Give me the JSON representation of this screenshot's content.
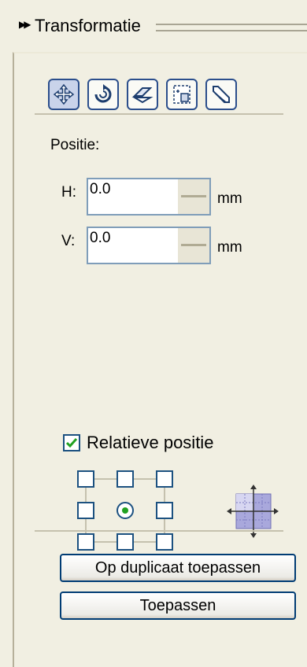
{
  "title": "Transformatie",
  "toolbar": {
    "buttons": [
      {
        "name": "position-icon",
        "active": true
      },
      {
        "name": "rotate-icon",
        "active": false
      },
      {
        "name": "mirror-icon",
        "active": false
      },
      {
        "name": "size-icon",
        "active": false
      },
      {
        "name": "skew-icon",
        "active": false
      }
    ]
  },
  "position": {
    "heading": "Positie:",
    "h_label": "H:",
    "h_value": "0.0",
    "h_unit": "mm",
    "v_label": "V:",
    "v_value": "0.0",
    "v_unit": "mm"
  },
  "relative": {
    "label": "Relatieve positie",
    "checked": true,
    "selected_anchor": "center"
  },
  "buttons": {
    "apply_duplicate": "Op duplicaat toepassen",
    "apply": "Toepassen"
  },
  "colors": {
    "accent": "#21a121",
    "border": "#1c5180"
  }
}
